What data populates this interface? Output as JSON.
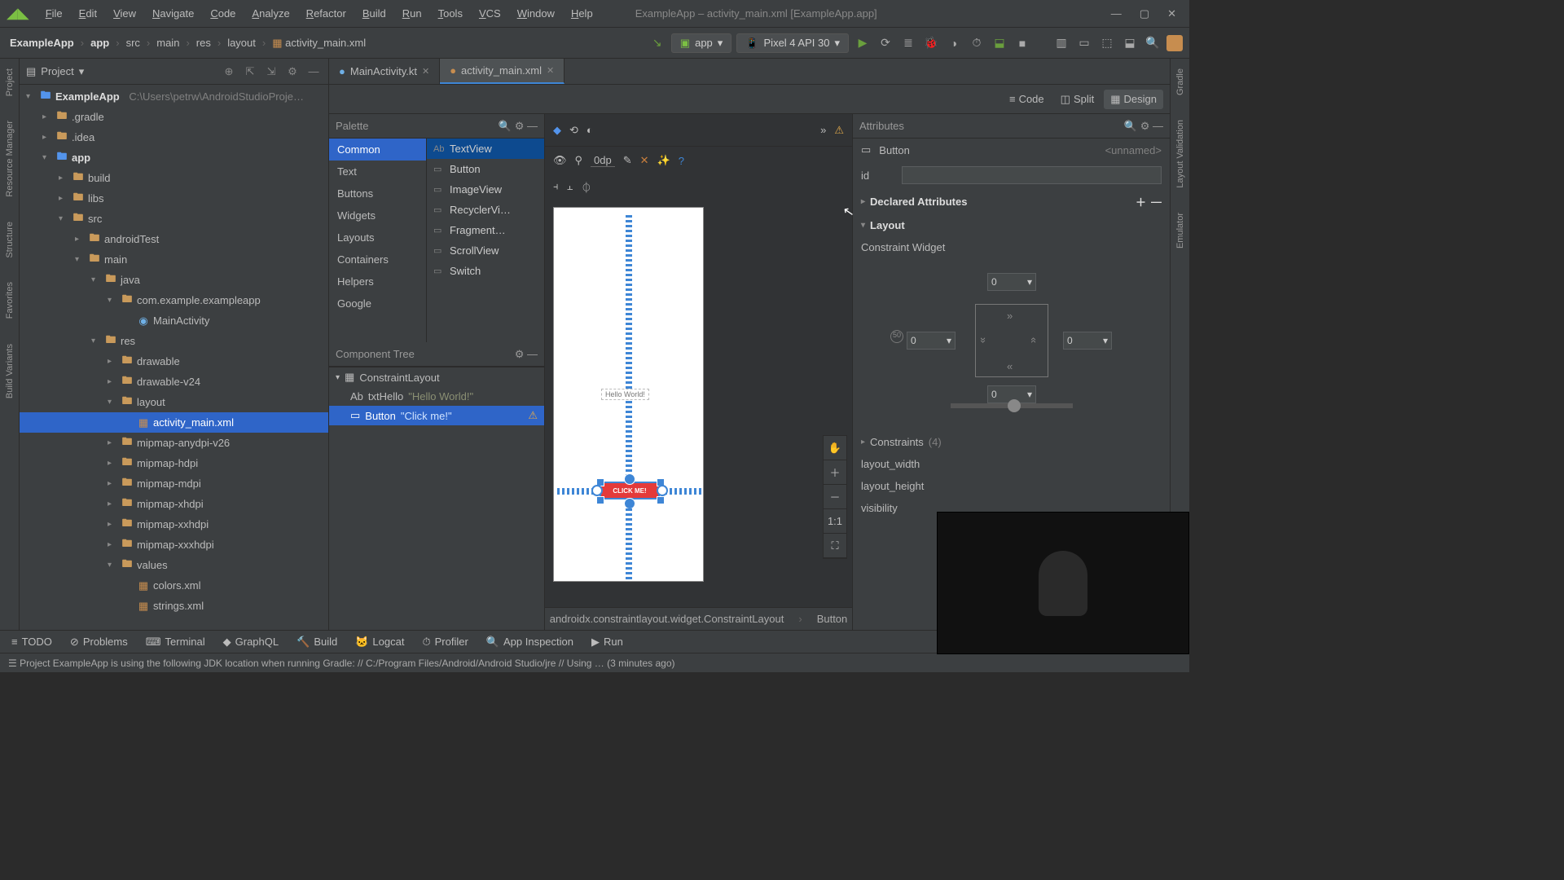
{
  "window": {
    "title": "ExampleApp – activity_main.xml [ExampleApp.app]"
  },
  "menu": [
    "File",
    "Edit",
    "View",
    "Navigate",
    "Code",
    "Analyze",
    "Refactor",
    "Build",
    "Run",
    "Tools",
    "VCS",
    "Window",
    "Help"
  ],
  "breadcrumbs": [
    "ExampleApp",
    "app",
    "src",
    "main",
    "res",
    "layout",
    "activity_main.xml"
  ],
  "run_config": {
    "module": "app",
    "device": "Pixel 4 API 30"
  },
  "project_header": "Project",
  "tree": {
    "root": "ExampleApp",
    "root_path": "C:\\Users\\petrw\\AndroidStudioProje…",
    "items": [
      {
        "indent": 1,
        "kind": "folder",
        "label": ".gradle"
      },
      {
        "indent": 1,
        "kind": "folder",
        "label": ".idea"
      },
      {
        "indent": 1,
        "kind": "module",
        "label": "app",
        "open": true
      },
      {
        "indent": 2,
        "kind": "folder",
        "label": "build"
      },
      {
        "indent": 2,
        "kind": "folder",
        "label": "libs"
      },
      {
        "indent": 2,
        "kind": "folder",
        "label": "src",
        "open": true
      },
      {
        "indent": 3,
        "kind": "folder",
        "label": "androidTest"
      },
      {
        "indent": 3,
        "kind": "folder",
        "label": "main",
        "open": true
      },
      {
        "indent": 4,
        "kind": "folder",
        "label": "java",
        "open": true
      },
      {
        "indent": 5,
        "kind": "pkg",
        "label": "com.example.exampleapp",
        "open": true
      },
      {
        "indent": 6,
        "kind": "kt",
        "label": "MainActivity"
      },
      {
        "indent": 4,
        "kind": "folder",
        "label": "res",
        "open": true
      },
      {
        "indent": 5,
        "kind": "folder",
        "label": "drawable"
      },
      {
        "indent": 5,
        "kind": "folder",
        "label": "drawable-v24"
      },
      {
        "indent": 5,
        "kind": "folder",
        "label": "layout",
        "open": true
      },
      {
        "indent": 6,
        "kind": "xml",
        "label": "activity_main.xml",
        "selected": true
      },
      {
        "indent": 5,
        "kind": "folder",
        "label": "mipmap-anydpi-v26"
      },
      {
        "indent": 5,
        "kind": "folder",
        "label": "mipmap-hdpi"
      },
      {
        "indent": 5,
        "kind": "folder",
        "label": "mipmap-mdpi"
      },
      {
        "indent": 5,
        "kind": "folder",
        "label": "mipmap-xhdpi"
      },
      {
        "indent": 5,
        "kind": "folder",
        "label": "mipmap-xxhdpi"
      },
      {
        "indent": 5,
        "kind": "folder",
        "label": "mipmap-xxxhdpi"
      },
      {
        "indent": 5,
        "kind": "folder",
        "label": "values",
        "open": true
      },
      {
        "indent": 6,
        "kind": "xml",
        "label": "colors.xml"
      },
      {
        "indent": 6,
        "kind": "xml",
        "label": "strings.xml"
      }
    ]
  },
  "editor_tabs": [
    {
      "label": "MainActivity.kt",
      "icon": "kt"
    },
    {
      "label": "activity_main.xml",
      "icon": "xml",
      "active": true
    }
  ],
  "design_modes": {
    "code": "Code",
    "split": "Split",
    "design": "Design"
  },
  "palette": {
    "title": "Palette",
    "categories": [
      "Common",
      "Text",
      "Buttons",
      "Widgets",
      "Layouts",
      "Containers",
      "Helpers",
      "Google"
    ],
    "items": [
      "TextView",
      "Button",
      "ImageView",
      "RecyclerVi…",
      "Fragment…",
      "ScrollView",
      "Switch"
    ]
  },
  "component_tree": {
    "title": "Component Tree",
    "root": "ConstraintLayout",
    "children": [
      {
        "id": "txtHello",
        "sub": "\"Hello World!\""
      },
      {
        "id": "Button",
        "sub": "\"Click me!\"",
        "warn": true,
        "selected": true
      }
    ]
  },
  "canvas": {
    "default_margin": "0dp",
    "button_text": "CLICK ME!",
    "hello_text": "Hello World!",
    "zoom_items": [
      "✋",
      "＋",
      "－",
      "1:1",
      "⛶"
    ]
  },
  "attributes": {
    "title": "Attributes",
    "selected_type": "Button",
    "selected_name": "<unnamed>",
    "id_label": "id",
    "id_value": "",
    "declared": "Declared Attributes",
    "layout": "Layout",
    "cw_label": "Constraint Widget",
    "top": "0",
    "left": "0",
    "right": "0",
    "bottom": "0",
    "constraints_label": "Constraints",
    "constraints_count": "(4)",
    "rows": [
      "layout_width",
      "layout_height",
      "visibility"
    ]
  },
  "bottom_bc": [
    "androidx.constraintlayout.widget.ConstraintLayout",
    "Button"
  ],
  "bottom_tools": [
    "TODO",
    "Problems",
    "Terminal",
    "GraphQL",
    "Build",
    "Logcat",
    "Profiler",
    "App Inspection",
    "Run"
  ],
  "status": "Project ExampleApp is using the following JDK location when running Gradle: // C:/Program Files/Android/Android Studio/jre // Using … (3 minutes ago)",
  "left_gutter": [
    "Project",
    "Resource Manager",
    "Structure",
    "Favorites",
    "Build Variants"
  ],
  "right_gutter": [
    "Gradle",
    "Layout Validation",
    "Emulator"
  ]
}
